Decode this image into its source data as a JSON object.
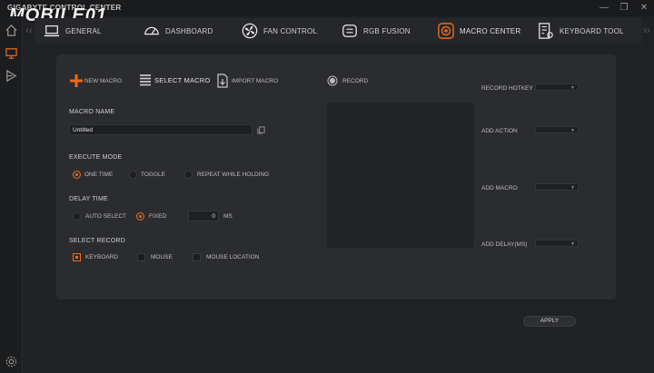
{
  "window": {
    "title": "GIGABYTE CONTROL CENTER",
    "watermark": "MOBILE01",
    "minimize": "—",
    "restore": "❐",
    "close": "✕"
  },
  "nav": {
    "tabs": [
      {
        "label": "GENERAL",
        "icon": "laptop-icon"
      },
      {
        "label": "DASHBOARD",
        "icon": "gauge-icon"
      },
      {
        "label": "FAN CONTROL",
        "icon": "fan-icon"
      },
      {
        "label": "RGB FUSION",
        "icon": "rgb-icon"
      },
      {
        "label": "MACRO CENTER",
        "icon": "macro-icon",
        "active": true
      },
      {
        "label": "KEYBOARD TOOL",
        "icon": "keyboard-icon"
      }
    ]
  },
  "toolbar": {
    "new_macro": "NEW MACRO",
    "select_macro": "SELECT MACRO",
    "import_macro": "IMPORT MACRO",
    "record": "RECORD"
  },
  "macro_name": {
    "label": "MACRO NAME",
    "value": "Untitled"
  },
  "execute_mode": {
    "label": "EXECUTE MODE",
    "options": [
      "ONE TIME",
      "TOGGLE",
      "REPEAT WHILE HOLDING"
    ],
    "selected": 0
  },
  "delay_time": {
    "label": "DELAY TIME",
    "options": [
      "AUTO SELECT",
      "FIXED"
    ],
    "selected": 1,
    "value": "0",
    "unit": "MS"
  },
  "select_record": {
    "label": "SELECT RECORD",
    "options": [
      "KEYBOARD",
      "MOUSE",
      "MOUSE LOCATION"
    ],
    "checked": [
      true,
      false,
      false
    ]
  },
  "right_fields": {
    "record_hotkey": "RECORD HOTKEY",
    "add_action": "ADD ACTION",
    "add_macro": "ADD MACRO",
    "add_delay": "ADD DELAY(MS)"
  },
  "apply": "APPLY",
  "colors": {
    "accent": "#e96a1c",
    "background": "#202124",
    "panel": "#2b2c2f"
  }
}
